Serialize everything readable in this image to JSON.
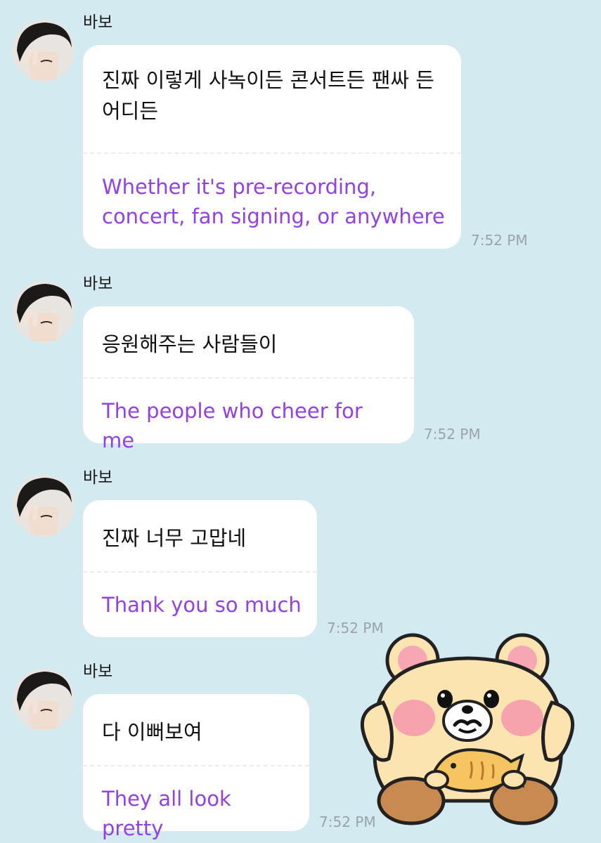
{
  "messages": [
    {
      "sender": "바보",
      "korean": "진짜 이렇게 사녹이든 콘서트든 팬싸 든 어디든",
      "english": "Whether it's pre-recording, concert, fan signing, or anywhere",
      "time": "7:52 PM"
    },
    {
      "sender": "바보",
      "korean": "응원해주는 사람들이",
      "english": "The people who cheer for me",
      "time": "7:52 PM"
    },
    {
      "sender": "바보",
      "korean": "진짜 너무 고맙네",
      "english": "Thank you so much",
      "time": "7:52 PM"
    },
    {
      "sender": "바보",
      "korean": "다 이뻐보여",
      "english": "They all look pretty",
      "time": "7:52 PM"
    }
  ],
  "sticker": {
    "icon": "bear-holding-taiyaki-sticker"
  },
  "colors": {
    "background": "#d4eaf1",
    "bubble": "#ffffff",
    "translation_text": "#9340e8",
    "timestamp": "#9aa3a8"
  }
}
